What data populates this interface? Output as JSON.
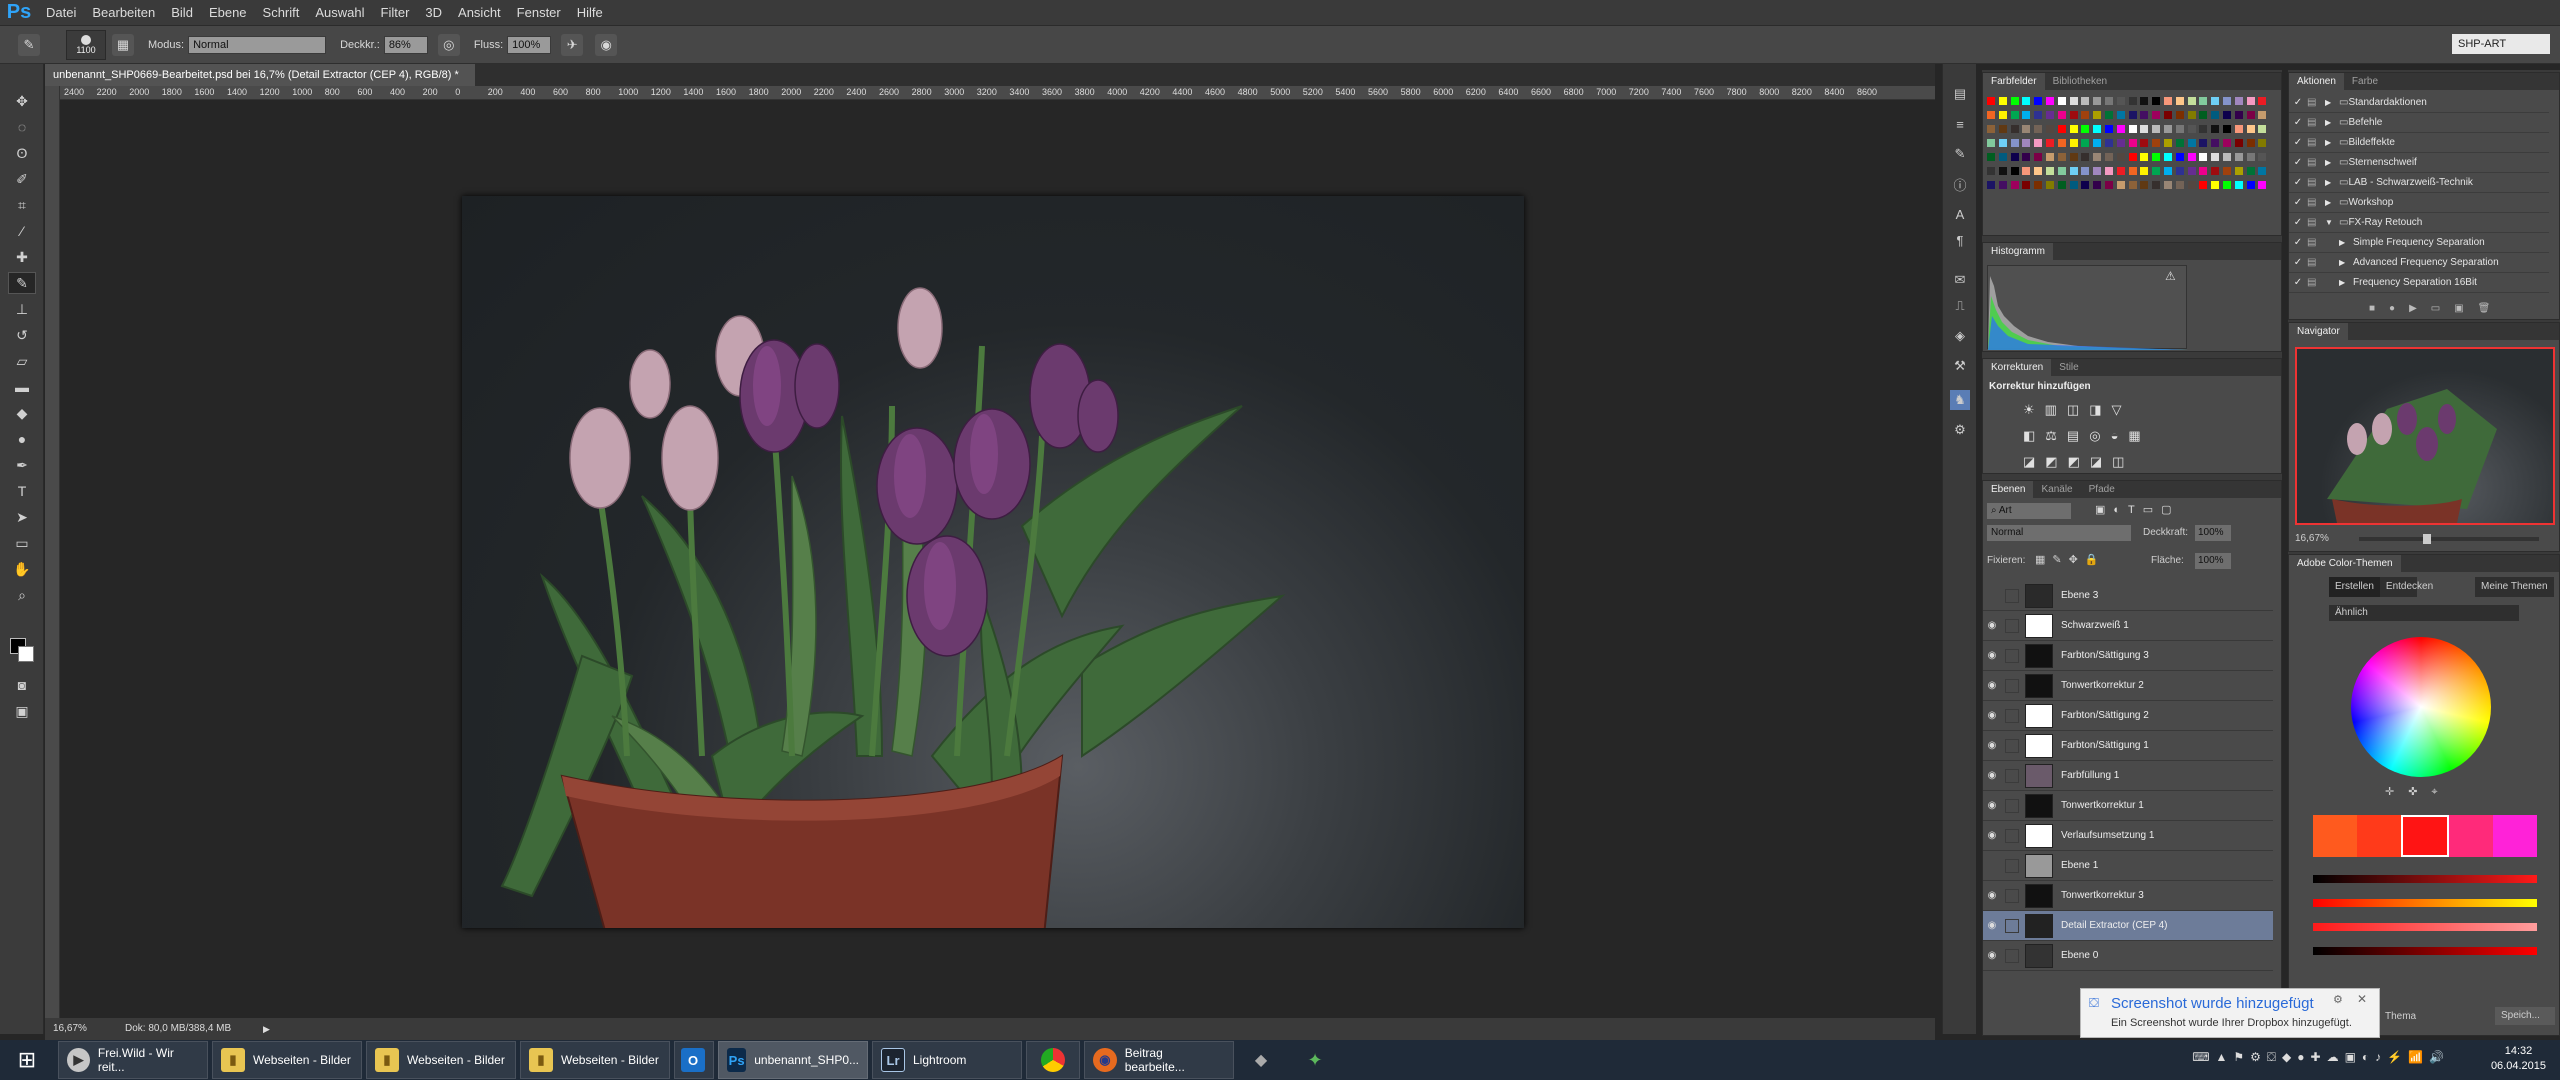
{
  "app": {
    "logo": "Ps",
    "workspace": "SHP-ART"
  },
  "menu": [
    "Datei",
    "Bearbeiten",
    "Bild",
    "Ebene",
    "Schrift",
    "Auswahl",
    "Filter",
    "3D",
    "Ansicht",
    "Fenster",
    "Hilfe"
  ],
  "options": {
    "brush_size": "1100",
    "mode_label": "Modus:",
    "mode_value": "Normal",
    "opacity_label": "Deckkr.:",
    "opacity_value": "86%",
    "flow_label": "Fluss:",
    "flow_value": "100%"
  },
  "document": {
    "tab_title": "unbenannt_SHP0669-Bearbeitet.psd bei 16,7% (Detail Extractor (CEP 4), RGB/8) *",
    "zoom": "16,67%",
    "doc_info": "Dok: 80,0 MB/388,4 MB"
  },
  "ruler_labels": [
    "2400",
    "2200",
    "2000",
    "1800",
    "1600",
    "1400",
    "1200",
    "1000",
    "800",
    "600",
    "400",
    "200",
    "0",
    "200",
    "400",
    "600",
    "800",
    "1000",
    "1200",
    "1400",
    "1600",
    "1800",
    "2000",
    "2200",
    "2400",
    "2600",
    "2800",
    "3000",
    "3200",
    "3400",
    "3600",
    "3800",
    "4000",
    "4200",
    "4400",
    "4600",
    "4800",
    "5000",
    "5200",
    "5400",
    "5600",
    "5800",
    "6000",
    "6200",
    "6400",
    "6600",
    "6800",
    "7000",
    "7200",
    "7400",
    "7600",
    "7800",
    "8000",
    "8200",
    "8400",
    "8600"
  ],
  "swatches_panel": {
    "tab1": "Farbfelder",
    "tab2": "Bibliotheken"
  },
  "histogram_panel": {
    "tab": "Histogramm"
  },
  "adjustments_panel": {
    "tab1": "Korrekturen",
    "tab2": "Stile",
    "title": "Korrektur hinzufügen"
  },
  "layers_panel": {
    "tab1": "Ebenen",
    "tab2": "Kanäle",
    "tab3": "Pfade",
    "filter": "Art",
    "blend": "Normal",
    "opacity_label": "Deckkraft:",
    "opacity": "100%",
    "lock_label": "Fixieren:",
    "fill_label": "Fläche:",
    "fill": "100%",
    "layers": [
      {
        "name": "Ebene 3",
        "visible": false
      },
      {
        "name": "Schwarzweiß 1",
        "visible": true
      },
      {
        "name": "Farbton/Sättigung 3",
        "visible": true
      },
      {
        "name": "Tonwertkorrektur 2",
        "visible": true
      },
      {
        "name": "Farbton/Sättigung 2",
        "visible": true
      },
      {
        "name": "Farbton/Sättigung 1",
        "visible": true
      },
      {
        "name": "Farbfüllung 1",
        "visible": true
      },
      {
        "name": "Tonwertkorrektur 1",
        "visible": true
      },
      {
        "name": "Verlaufsumsetzung 1",
        "visible": true
      },
      {
        "name": "Ebene 1",
        "visible": false
      },
      {
        "name": "Tonwertkorrektur 3",
        "visible": true
      },
      {
        "name": "Detail Extractor (CEP 4)",
        "visible": true,
        "selected": true
      },
      {
        "name": "Ebene 0",
        "visible": true
      }
    ]
  },
  "actions_panel": {
    "tab1": "Aktionen",
    "tab2": "Farbe",
    "items": [
      "Standardaktionen",
      "Befehle",
      "Bildeffekte",
      "Sternenschweif",
      "LAB - Schwarzweiß-Technik",
      "Workshop",
      "FX-Ray Retouch",
      "Simple Frequency Separation",
      "Advanced Frequency Separation",
      "Frequency Separation 16Bit"
    ]
  },
  "navigator_panel": {
    "tab": "Navigator",
    "zoom": "16,67%"
  },
  "color_themes_panel": {
    "tab": "Adobe Color-Themen",
    "btn_create": "Erstellen",
    "btn_explore": "Entdecken",
    "btn_mine": "Meine Themen",
    "rule": "Ähnlich",
    "footer1": "Thema",
    "footer2": "Speich..."
  },
  "toast": {
    "title": "Screenshot wurde hinzugefügt",
    "body": "Ein Screenshot wurde Ihrer Dropbox hinzugefügt."
  },
  "taskbar": {
    "items": [
      "Frei.Wild - Wir reit...",
      "Webseiten - Bilder",
      "Webseiten - Bilder",
      "Webseiten - Bilder",
      "",
      "unbenannt_SHP0...",
      "Lightroom",
      "",
      "Beitrag bearbeite..."
    ],
    "time": "14:32",
    "date": "06.04.2015"
  },
  "colors": {
    "accent": "#2fa3f7",
    "selected_layer": "#6d7c99",
    "taskbar": "#1f2a38",
    "theme": [
      "#ff5a1e",
      "#ff3a1a",
      "#ff1414",
      "#ff2a7a",
      "#ff22d8"
    ]
  }
}
